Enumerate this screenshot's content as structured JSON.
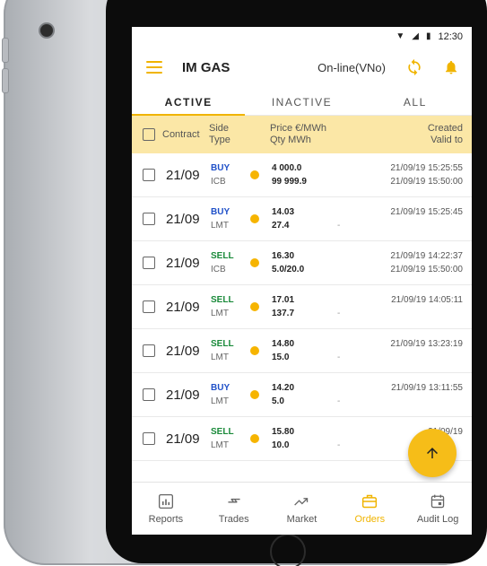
{
  "status_bar": {
    "time": "12:30"
  },
  "header": {
    "app_title": "IM GAS",
    "connection_status": "On-line(VNo)"
  },
  "tabs": [
    {
      "label": "ACTIVE",
      "active": true
    },
    {
      "label": "INACTIVE",
      "active": false
    },
    {
      "label": "ALL",
      "active": false
    }
  ],
  "list_header": {
    "contract": "Contract",
    "side": "Side",
    "type": "Type",
    "price": "Price €/MWh",
    "qty": "Qty MWh",
    "created": "Created",
    "valid_to": "Valid to"
  },
  "orders": [
    {
      "contract": "21/09",
      "side": "BUY",
      "type": "ICB",
      "price": "4 000.0",
      "qty": "99 999.9",
      "created": "21/09/19 15:25:55",
      "valid_to": "21/09/19 15:50:00"
    },
    {
      "contract": "21/09",
      "side": "BUY",
      "type": "LMT",
      "price": "14.03",
      "qty": "27.4",
      "created": "21/09/19 15:25:45",
      "valid_to": "-"
    },
    {
      "contract": "21/09",
      "side": "SELL",
      "type": "ICB",
      "price": "16.30",
      "qty": "5.0/20.0",
      "created": "21/09/19 14:22:37",
      "valid_to": "21/09/19 15:50:00"
    },
    {
      "contract": "21/09",
      "side": "SELL",
      "type": "LMT",
      "price": "17.01",
      "qty": "137.7",
      "created": "21/09/19 14:05:11",
      "valid_to": "-"
    },
    {
      "contract": "21/09",
      "side": "SELL",
      "type": "LMT",
      "price": "14.80",
      "qty": "15.0",
      "created": "21/09/19 13:23:19",
      "valid_to": "-"
    },
    {
      "contract": "21/09",
      "side": "BUY",
      "type": "LMT",
      "price": "14.20",
      "qty": "5.0",
      "created": "21/09/19 13:11:55",
      "valid_to": "-"
    },
    {
      "contract": "21/09",
      "side": "SELL",
      "type": "LMT",
      "price": "15.80",
      "qty": "10.0",
      "created": "21/09/19",
      "valid_to": "-"
    }
  ],
  "bottom_nav": [
    {
      "label": "Reports",
      "icon": "reports-icon",
      "active": false
    },
    {
      "label": "Trades",
      "icon": "trades-icon",
      "active": false
    },
    {
      "label": "Market",
      "icon": "market-icon",
      "active": false
    },
    {
      "label": "Orders",
      "icon": "orders-icon",
      "active": true
    },
    {
      "label": "Audit Log",
      "icon": "audit-log-icon",
      "active": false
    }
  ],
  "colors": {
    "accent": "#f0b400",
    "header_band": "#fbe7a6",
    "buy": "#1f50c8",
    "sell": "#1a8a3a",
    "status_dot": "#f6b400"
  }
}
